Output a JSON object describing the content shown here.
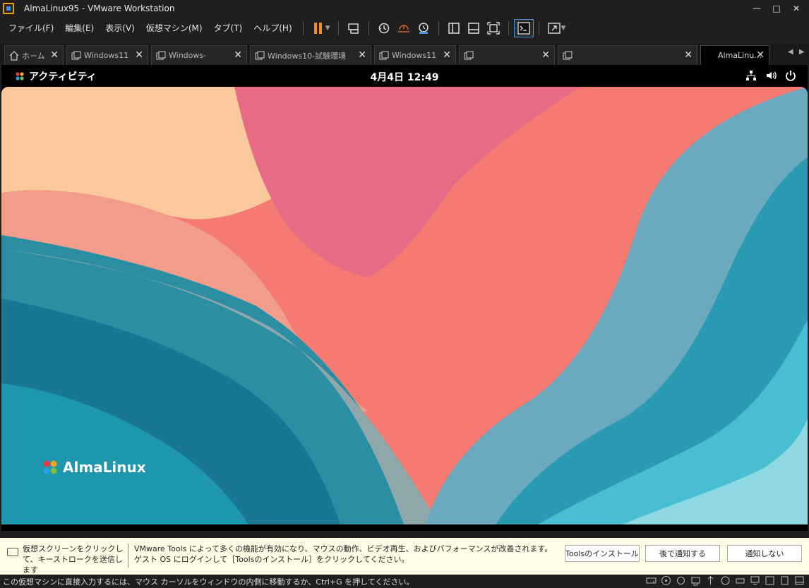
{
  "window": {
    "title": "AlmaLinux95 - VMware Workstation"
  },
  "menu": [
    "ファイル(F)",
    "編集(E)",
    "表示(V)",
    "仮想マシン(M)",
    "タブ(T)",
    "ヘルプ(H)"
  ],
  "tabs": [
    {
      "label": "ホーム",
      "icon": "home-icon"
    },
    {
      "label": "Windows11",
      "icon": "vm-icon"
    },
    {
      "label": "Windows-",
      "icon": "vm-icon"
    },
    {
      "label": "Windows10-試験環境",
      "icon": "vm-icon"
    },
    {
      "label": "Windows11",
      "icon": "vm-icon"
    },
    {
      "label": "",
      "icon": "vm-icon"
    },
    {
      "label": "",
      "icon": "vm-icon"
    },
    {
      "label": "AlmaLinu…",
      "icon": "",
      "active": true
    }
  ],
  "guest": {
    "activities": "アクティビティ",
    "clock": "4月4日  12:49",
    "logo_text": "AlmaLinux"
  },
  "notification": {
    "hint": "仮想スクリーンをクリックして、キーストロークを送信します",
    "message": "VMware Tools によって多くの機能が有効になり、マウスの動作、ビデオ再生、およびパフォーマンスが改善されます。ゲスト OS にログインして［Toolsのインストール］をクリックしてください。",
    "buttons": [
      "Toolsのインストール",
      "後で通知する",
      "通知しない"
    ]
  },
  "status": {
    "text": "この仮想マシンに直接入力するには、マウス カーソルをウィンドウの内側に移動するか、Ctrl+G を押してください。"
  },
  "colors": {
    "accent": "#4a90d9",
    "pause": "#f28c28",
    "notify_bg": "#fffde8"
  }
}
